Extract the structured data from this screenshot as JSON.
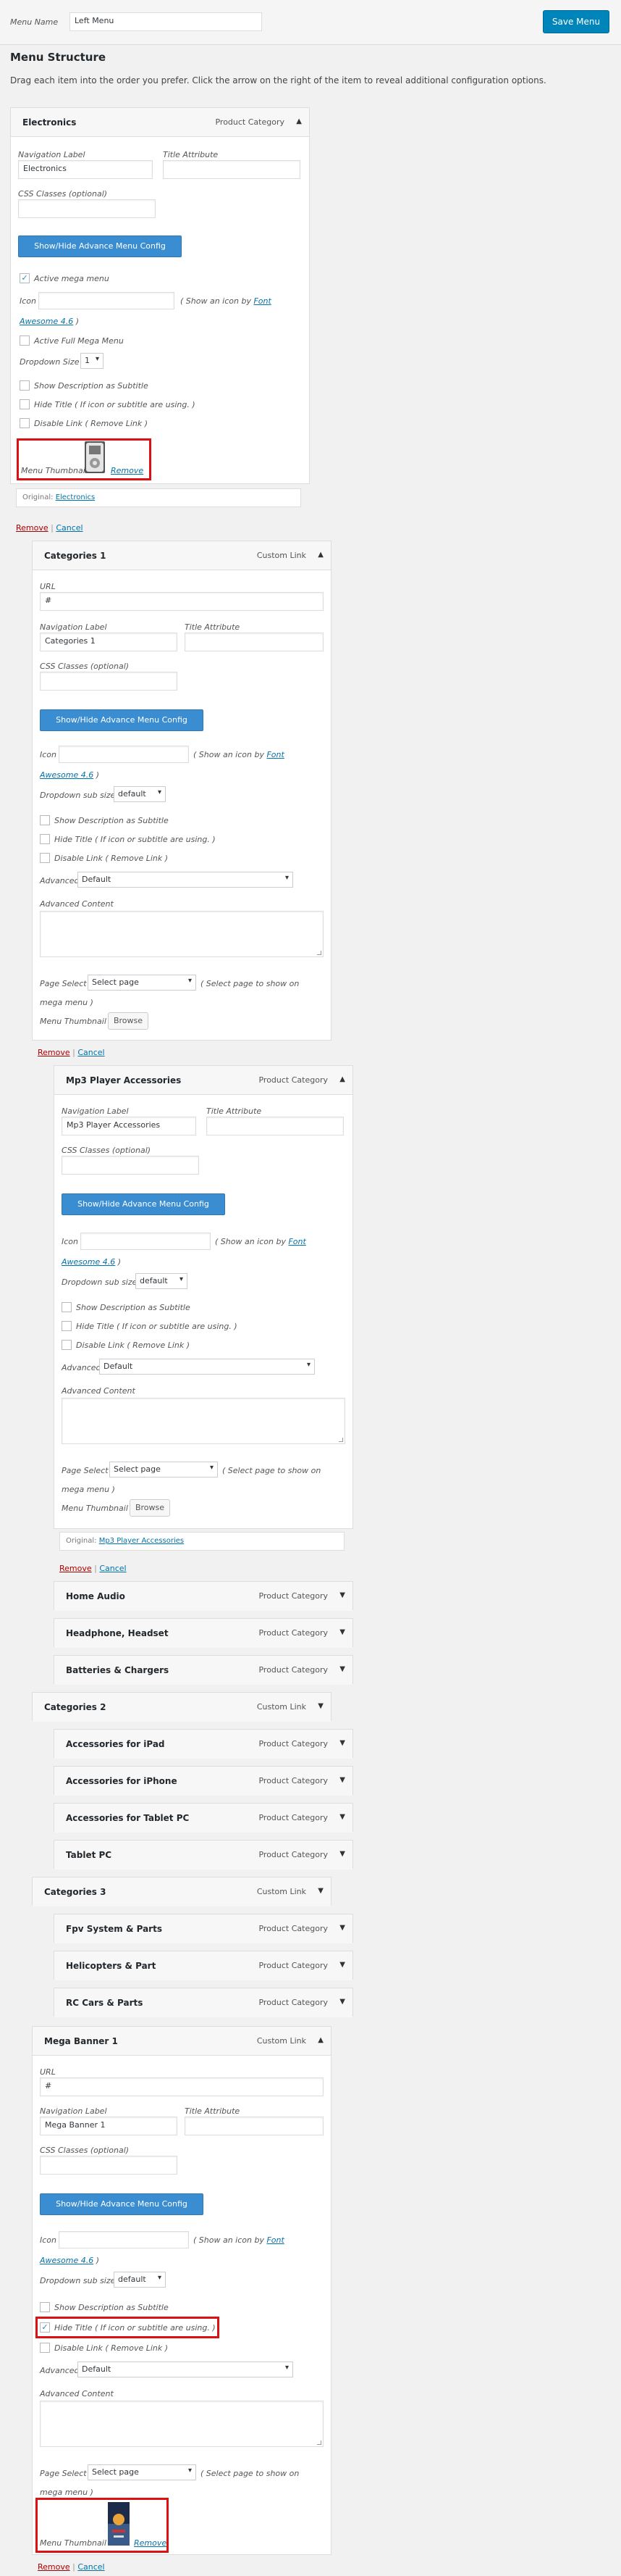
{
  "top": {
    "menu_name_label": "Menu Name",
    "menu_name_value": "Left Menu",
    "save_button": "Save Menu",
    "structure_title": "Menu Structure",
    "structure_desc": "Drag each item into the order you prefer. Click the arrow on the right of the item to reveal additional configuration options."
  },
  "common": {
    "url_label": "URL",
    "nav_label": "Navigation Label",
    "title_attr": "Title Attribute",
    "css_classes": "CSS Classes (optional)",
    "show_hide_btn": "Show/Hide Advance Menu Config",
    "icon_label": "Icon",
    "icon_hint_pre": "( Show an icon by ",
    "icon_hint_link": "Font",
    "icon_hint_link2": "Awesome 4.6",
    "icon_hint_post": " )",
    "dropdown_sub_size": "Dropdown sub size",
    "show_desc": "Show Description as Subtitle",
    "hide_title": "Hide Title ( If icon or subtitle are using. )",
    "disable_link": "Disable Link ( Remove Link )",
    "advanced": "Advanced",
    "advanced_value": "Default",
    "advanced_content": "Advanced Content",
    "page_select": "Page Select",
    "page_select_value": "Select page",
    "page_select_hint": "( Select page to show on",
    "page_select_hint2": "mega menu )",
    "menu_thumbnail": "Menu Thumbnail",
    "browse": "Browse",
    "remove": "Remove",
    "cancel": "Cancel",
    "separator": " | ",
    "original": "Original:",
    "default_option": "default",
    "arrow_up": "▲",
    "arrow_down": "▼",
    "check_mark": "✓",
    "select_arrow": "▾"
  },
  "electronics": {
    "title": "Electronics",
    "type": "Product Category",
    "nav_value": "Electronics",
    "active_mega": "Active mega menu",
    "active_full_mega": "Active Full Mega Menu",
    "dropdown_size": "Dropdown Size",
    "dropdown_size_value": "1",
    "original_link": "Electronics"
  },
  "categories1": {
    "title": "Categories 1",
    "type": "Custom Link",
    "url_value": "#",
    "nav_value": "Categories 1"
  },
  "mp3": {
    "title": "Mp3 Player Accessories",
    "type": "Product Category",
    "nav_value": "Mp3 Player Accessories",
    "original_link": "Mp3 Player Accessories"
  },
  "closed_items": [
    {
      "title": "Home Audio",
      "type": "Product Category"
    },
    {
      "title": "Headphone, Headset",
      "type": "Product Category"
    },
    {
      "title": "Batteries & Chargers",
      "type": "Product Category"
    },
    {
      "title": "Categories 2",
      "type": "Custom Link"
    },
    {
      "title": "Accessories for iPad",
      "type": "Product Category"
    },
    {
      "title": "Accessories for iPhone",
      "type": "Product Category"
    },
    {
      "title": "Accessories for Tablet PC",
      "type": "Product Category"
    },
    {
      "title": "Tablet PC",
      "type": "Product Category"
    },
    {
      "title": "Categories 3",
      "type": "Custom Link"
    },
    {
      "title": "Fpv System & Parts",
      "type": "Product Category"
    },
    {
      "title": "Helicopters & Part",
      "type": "Product Category"
    },
    {
      "title": "RC Cars & Parts",
      "type": "Product Category"
    }
  ],
  "mega_banner": {
    "title": "Mega Banner 1",
    "type": "Custom Link",
    "url_value": "#",
    "nav_value": "Mega Banner 1"
  },
  "colors": {
    "highlight": "#dd1111",
    "accent": "#0085ba",
    "link": "#0073aa"
  }
}
